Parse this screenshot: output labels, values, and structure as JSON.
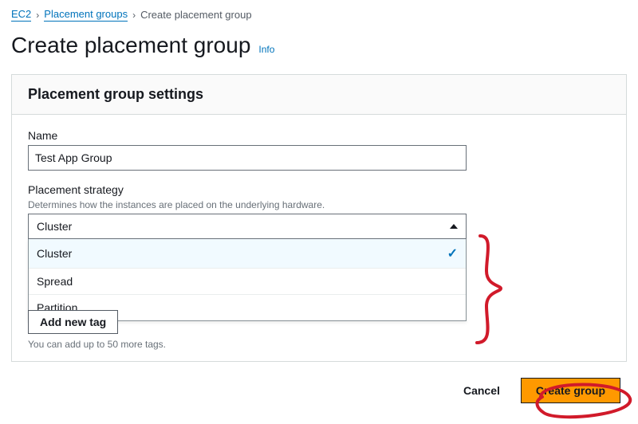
{
  "breadcrumb": {
    "root": "EC2",
    "mid": "Placement groups",
    "current": "Create placement group"
  },
  "page": {
    "title": "Create placement group",
    "info": "Info"
  },
  "panel": {
    "header": "Placement group settings"
  },
  "fields": {
    "name_label": "Name",
    "name_value": "Test App Group",
    "strategy_label": "Placement strategy",
    "strategy_desc": "Determines how the instances are placed on the underlying hardware.",
    "strategy_selected": "Cluster",
    "strategy_options": [
      "Cluster",
      "Spread",
      "Partition"
    ]
  },
  "tags": {
    "add_btn": "Add new tag",
    "hint": "You can add up to 50 more tags."
  },
  "footer": {
    "cancel": "Cancel",
    "create": "Create group"
  },
  "colors": {
    "link": "#0073bb",
    "primary": "#ff9900",
    "annotation": "#d11a2a"
  }
}
